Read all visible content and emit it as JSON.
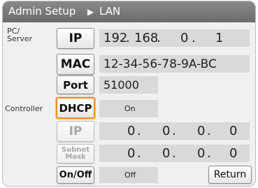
{
  "title": {
    "left": "Admin Setup",
    "arrow": "▶",
    "right": "LAN"
  },
  "sections": {
    "pc_server": "PC/\nServer",
    "controller": "Controller"
  },
  "pc": {
    "ip_button": "IP",
    "ip": [
      "192",
      ".",
      "168",
      ".",
      "0",
      ".",
      "1"
    ],
    "mac_button": "MAC",
    "mac": "12-34-56-78-9A-BC",
    "port_button": "Port",
    "port": "51000"
  },
  "controller": {
    "dhcp_button": "DHCP",
    "dhcp_value": "On",
    "ip_button": "IP",
    "ip": [
      "0",
      ".",
      "0",
      ".",
      "0",
      ".",
      "0"
    ],
    "subnet_button": "Subnet\nMask",
    "subnet": [
      "0",
      ".",
      "0",
      ".",
      "0",
      ".",
      "0"
    ],
    "onoff_button": "On/Off",
    "onoff_value": "Off"
  },
  "return_button": "Return",
  "colors": {
    "title_bar": "#7a7a7a",
    "highlight": "#e8902a",
    "field": "#d9d9d9"
  }
}
